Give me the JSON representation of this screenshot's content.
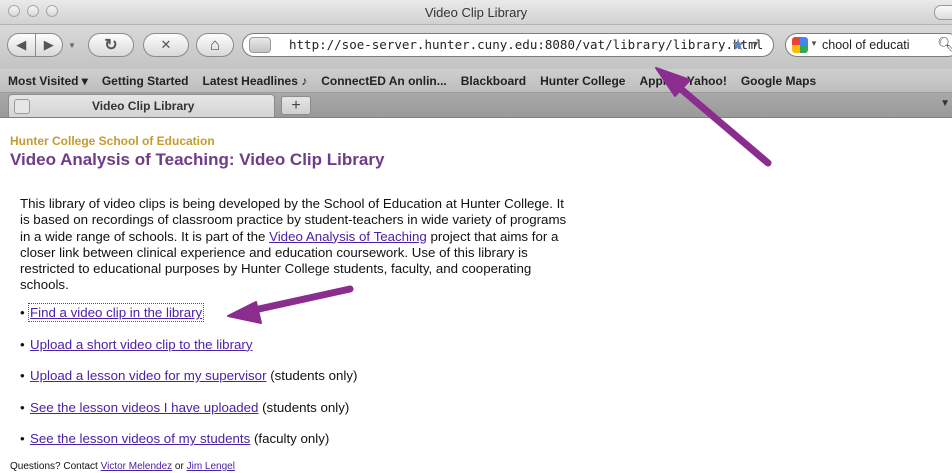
{
  "window": {
    "title": "Video Clip Library"
  },
  "toolbar": {
    "back_glyph": "◀",
    "forward_glyph": "▶",
    "reload_glyph": "↻",
    "stop_glyph": "✕",
    "home_glyph": "⌂",
    "url": "http://soe-server.hunter.cuny.edu:8080/vat/library/library.html",
    "search_text": "chool of educati",
    "search_icon": "search-icon"
  },
  "bookmarks": [
    "Most Visited ▾",
    "Getting Started",
    "Latest Headlines ♪",
    "ConnectED An onlin...",
    "Blackboard",
    "Hunter College",
    "Apple",
    "Yahoo!",
    "Google Maps"
  ],
  "tabs": [
    {
      "label": "Video Clip Library"
    }
  ],
  "page": {
    "org": "Hunter College School of Education",
    "heading": "Video Analysis of Teaching: Video Clip Library",
    "intro_before": "This library of video clips is being developed by the School of Education at Hunter College. It is based on recordings of classroom practice by student-teachers in wide variety of programs in a wide range of schools. It is part of the ",
    "intro_link": "Video Analysis of Teaching",
    "intro_after": " project that aims for a closer link between clinical experience and education coursework. Use of this library is restricted to educational purposes by Hunter College students, faculty, and cooperating schools.",
    "links": [
      {
        "link": "Find a video clip in the library",
        "note": ""
      },
      {
        "link": "Upload a short video clip to the library",
        "note": ""
      },
      {
        "link": "Upload a lesson video for my supervisor",
        "note": " (students only)"
      },
      {
        "link": "See the lesson videos I have uploaded",
        "note": " (students only)"
      },
      {
        "link": "See the lesson videos of my students",
        "note": " (faculty only)"
      }
    ],
    "contact_prefix": "Questions? Contact ",
    "contact_1": "Victor Melendez",
    "contact_mid": " or ",
    "contact_2": "Jim Lengel"
  },
  "annotation_color": "#8b2c8f",
  "link_color": "#4b21a8"
}
